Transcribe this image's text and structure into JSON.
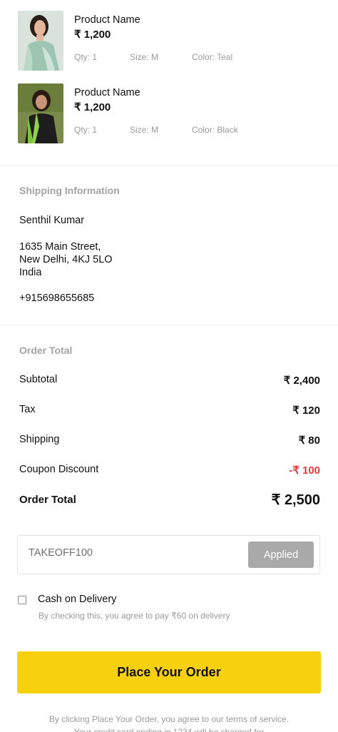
{
  "products": [
    {
      "name": "Product Name",
      "price": "₹ 1,200",
      "qty": "Qty: 1",
      "size": "Size: M",
      "color": "Color: Teal"
    },
    {
      "name": "Product Name",
      "price": "₹ 1,200",
      "qty": "Qty: 1",
      "size": "Size: M",
      "color": "Color: Black"
    }
  ],
  "shipping": {
    "title": "Shipping Information",
    "name": "Senthil Kumar",
    "address_line1": "1635 Main Street,",
    "address_line2": "New Delhi, 4KJ 5LO",
    "address_line3": "India",
    "phone": "+915698655685"
  },
  "order_total": {
    "title": "Order Total",
    "subtotal_label": "Subtotal",
    "subtotal_value": "₹ 2,400",
    "tax_label": "Tax",
    "tax_value": "₹ 120",
    "shipping_label": "Shipping",
    "shipping_value": "₹ 80",
    "discount_label": "Coupon Discount",
    "discount_value": "-₹ 100",
    "total_label": "Order Total",
    "total_value": "₹ 2,500"
  },
  "coupon": {
    "value": "TAKEOFF100",
    "button_label": "Applied"
  },
  "cod": {
    "label": "Cash on Delivery",
    "hint": "By checking this, you agree to pay ₹60 on delivery",
    "checked": false
  },
  "place_order": {
    "label": "Place Your Order"
  },
  "terms": {
    "text": "By clicking Place Your Order, you agree to our terms of service. Your credit card ending in 1234 will be charged for"
  },
  "colors": {
    "accent": "#f7d10e",
    "discount": "#e53935",
    "muted": "#9a9a9a",
    "disabled_button": "#a9a9a9"
  },
  "icons": {
    "product_1_thumbnail": "product-image-teal-dress",
    "product_2_thumbnail": "product-image-black-dress",
    "cod_checkbox": "checkbox-icon"
  }
}
